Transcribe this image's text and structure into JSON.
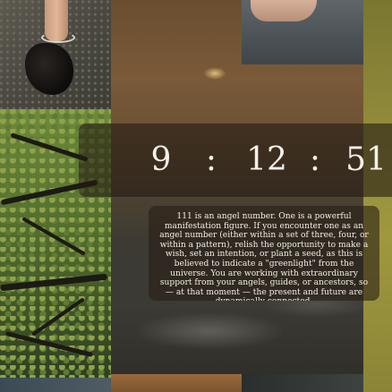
{
  "clock": {
    "hours": "9",
    "separator": ":",
    "minutes": "12",
    "seconds": "51"
  },
  "message": {
    "text": "111 is an angel number. One is a powerful manifestation figure. If you encounter one as an angel number (either within a set of three, four, or within a pattern), relish the opportunity to make a wish, set an intention, or plant a seed, as this is believed to indicate a \"greenlight\" from the universe. You are working with extraordinary support from your angels, guides, or ancestors, so — at that moment — the present and future are dynamically connected."
  },
  "colors": {
    "panel": "#231a12",
    "text": "#f6f1ea",
    "mustard": "#8f8a3a"
  }
}
